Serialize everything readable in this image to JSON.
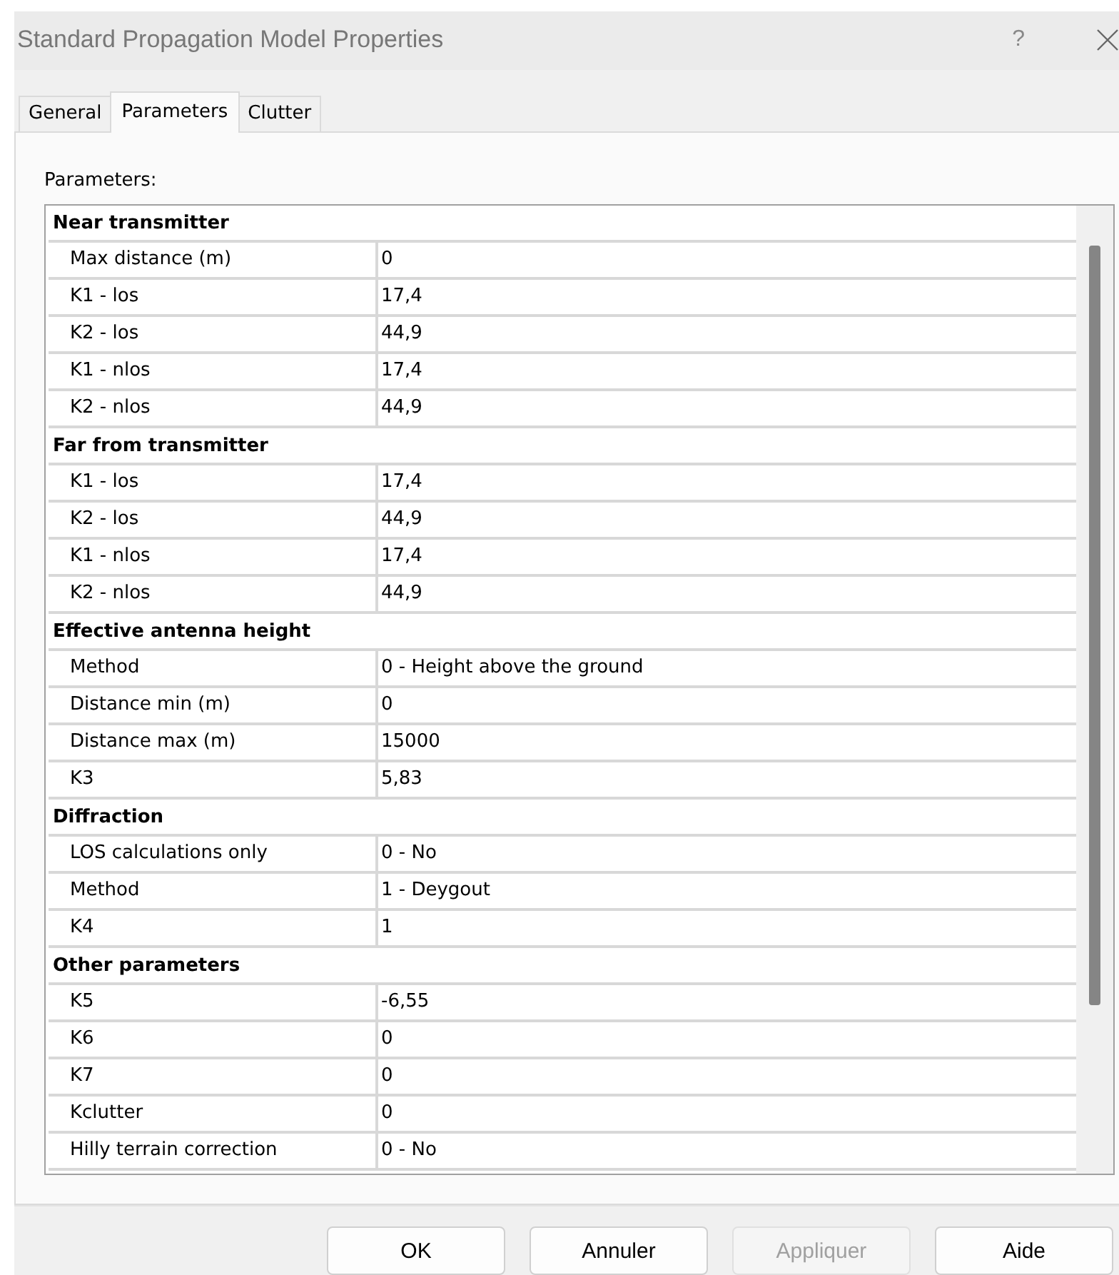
{
  "window": {
    "title": "Standard Propagation Model Properties",
    "help": "?"
  },
  "tabs": [
    {
      "label": "General",
      "selected": false
    },
    {
      "label": "Parameters",
      "selected": true
    },
    {
      "label": "Clutter",
      "selected": false
    }
  ],
  "section_label": "Parameters:",
  "groups": [
    {
      "title": "Near transmitter",
      "rows": [
        {
          "name": "Max distance (m)",
          "value": "0"
        },
        {
          "name": "K1 - los",
          "value": "17,4"
        },
        {
          "name": "K2 - los",
          "value": "44,9"
        },
        {
          "name": "K1 - nlos",
          "value": "17,4"
        },
        {
          "name": "K2 - nlos",
          "value": "44,9"
        }
      ]
    },
    {
      "title": "Far from transmitter",
      "rows": [
        {
          "name": "K1 - los",
          "value": "17,4"
        },
        {
          "name": "K2 - los",
          "value": "44,9"
        },
        {
          "name": "K1 - nlos",
          "value": "17,4"
        },
        {
          "name": "K2 - nlos",
          "value": "44,9"
        }
      ]
    },
    {
      "title": "Effective antenna height",
      "rows": [
        {
          "name": "Method",
          "value": "0 - Height above the ground"
        },
        {
          "name": "Distance min (m)",
          "value": "0"
        },
        {
          "name": "Distance max (m)",
          "value": "15000"
        },
        {
          "name": "K3",
          "value": "5,83"
        }
      ]
    },
    {
      "title": "Diffraction",
      "rows": [
        {
          "name": "LOS calculations only",
          "value": "0 - No"
        },
        {
          "name": "Method",
          "value": "1 - Deygout"
        },
        {
          "name": "K4",
          "value": "1"
        }
      ]
    },
    {
      "title": "Other parameters",
      "rows": [
        {
          "name": "K5",
          "value": "-6,55"
        },
        {
          "name": "K6",
          "value": "0"
        },
        {
          "name": "K7",
          "value": "0"
        },
        {
          "name": "Kclutter",
          "value": "0"
        },
        {
          "name": "Hilly terrain correction",
          "value": "0 - No"
        }
      ]
    }
  ],
  "buttons": [
    {
      "label": "OK",
      "disabled": false
    },
    {
      "label": "Annuler",
      "disabled": false
    },
    {
      "label": "Appliquer",
      "disabled": true
    },
    {
      "label": "Aide",
      "disabled": false
    }
  ]
}
